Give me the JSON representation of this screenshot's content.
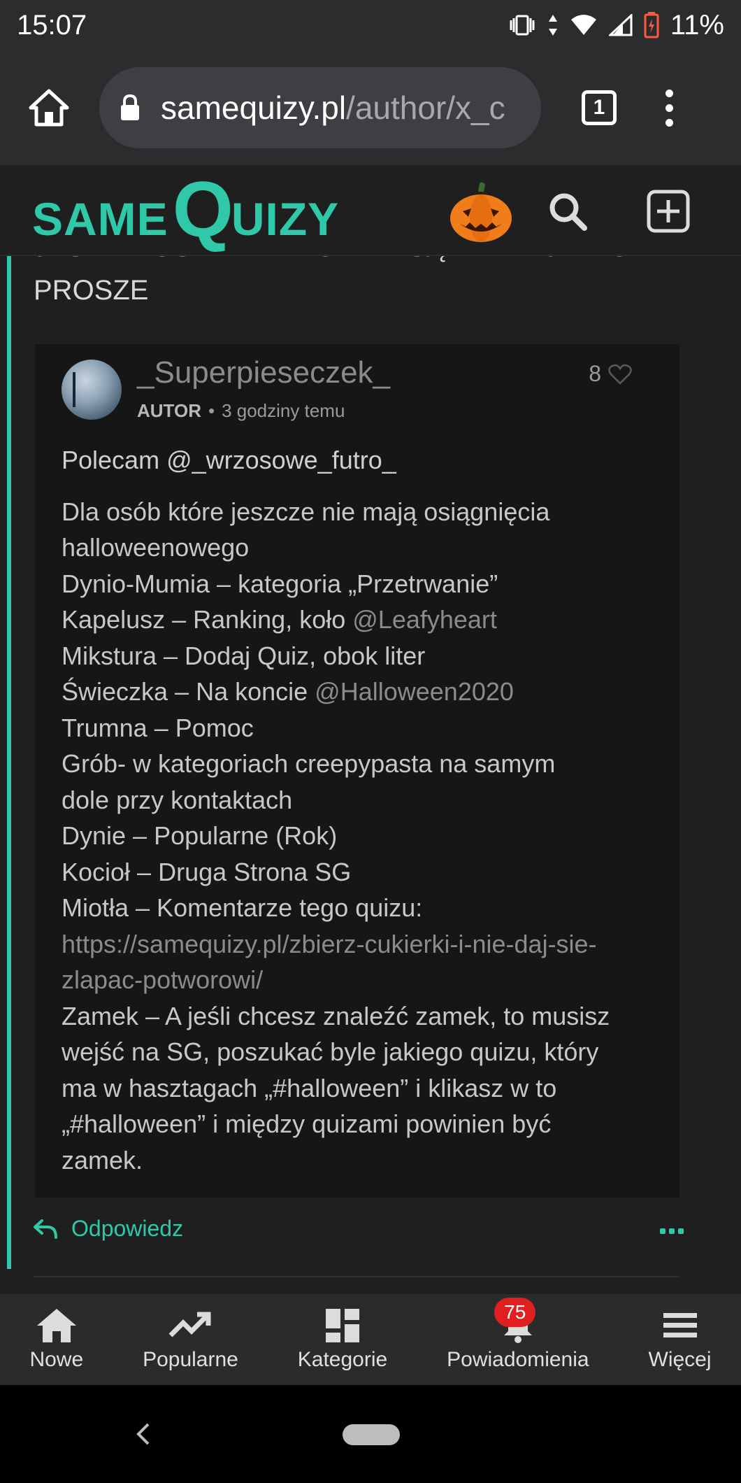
{
  "status_bar": {
    "time": "15:07",
    "battery": "11%"
  },
  "browser": {
    "url_host": "samequizy.pl",
    "url_path": "/author/x_c",
    "tab_count": "1"
  },
  "site": {
    "logo_same": "SAME",
    "logo_q": "Q",
    "logo_uizy": "UIZY"
  },
  "prev_comment": {
    "text": "JEŚLI KTOŚ NIE WIE GDZIE SĄ NAKLEJKI TO PROSZE"
  },
  "reply": {
    "author": "_Superpieseczek_",
    "badge": "AUTOR",
    "time": "3 godziny temu",
    "likes": "8",
    "first_line": "Polecam @_wrzosowe_futro_",
    "lines": [
      "Dla osób które jeszcze nie mają osiągnięcia",
      "halloweenowego",
      "Dynio-Mumia – kategoria „Przetrwanie”",
      "Kapelusz – Ranking, koło ",
      "Mikstura – Dodaj Quiz, obok liter",
      "Świeczka – Na koncie ",
      "Trumna – Pomoc",
      "Grób- w kategoriach creepypasta na samym",
      "dole przy kontaktach",
      "Dynie – Popularne (Rok)",
      "Kocioł – Druga Strona SG",
      "Miotła – Komentarze tego quizu:"
    ],
    "mention_leafy": "@Leafyheart",
    "mention_halloween": "@Halloween2020",
    "link_line1": "https://samequizy.pl/zbierz-cukierki-i-nie-daj-sie-",
    "link_line2": "zlapac-potworowi/",
    "tail_lines": [
      "Zamek – A jeśli chcesz znaleźć zamek, to musisz",
      "wejść na SG, poszukać byle jakiego quizu, który",
      "ma w hasztagach „#halloween” i klikasz w to",
      "„#halloween” i między quizami powinien być",
      "zamek."
    ]
  },
  "actions": {
    "reply_label": "Odpowiedz"
  },
  "bottom_nav": [
    {
      "label": "Nowe",
      "icon": "home-icon"
    },
    {
      "label": "Popularne",
      "icon": "trending-icon"
    },
    {
      "label": "Kategorie",
      "icon": "dashboard-icon"
    },
    {
      "label": "Powiadomienia",
      "icon": "bell-icon",
      "badge": "75"
    },
    {
      "label": "Więcej",
      "icon": "menu-icon"
    }
  ],
  "colors": {
    "accent": "#2fc8a8",
    "badge_red": "#e02020",
    "background": "#1f1f1f"
  }
}
